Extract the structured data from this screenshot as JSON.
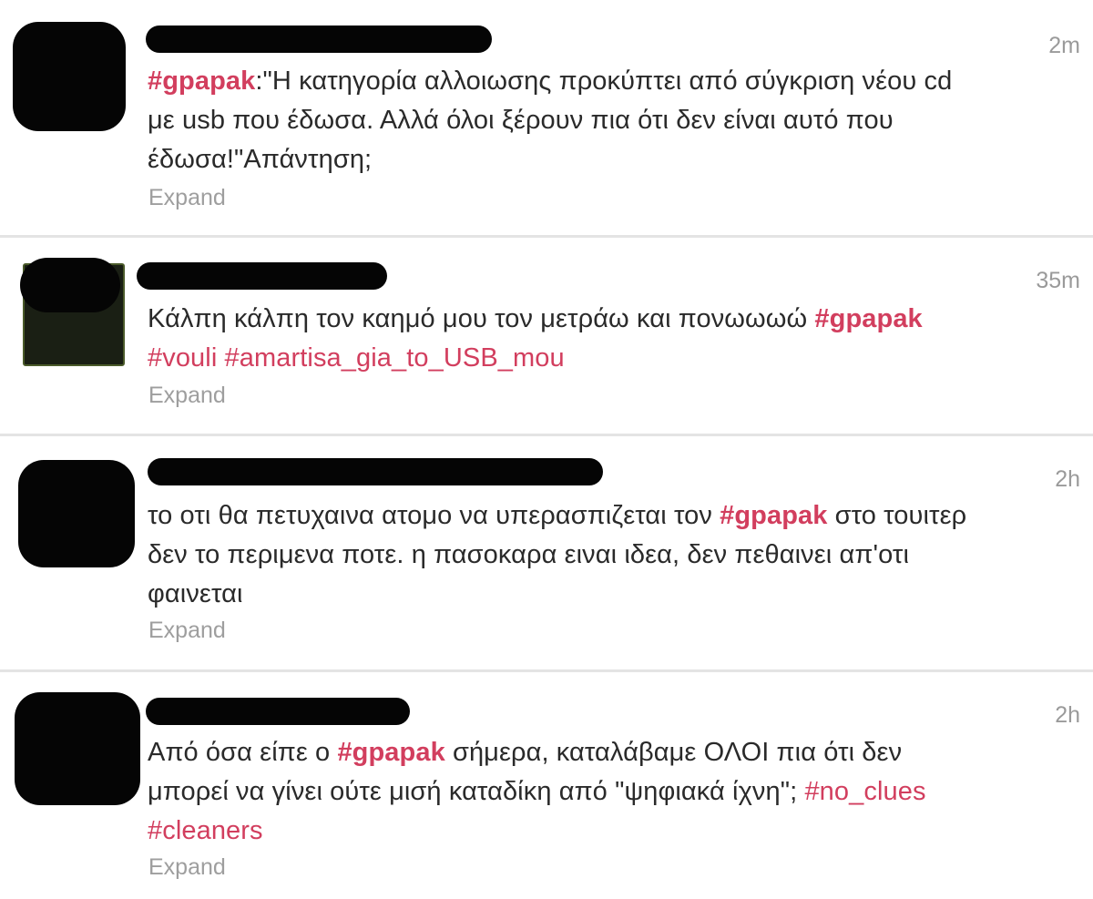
{
  "timeline": {
    "tweets": [
      {
        "time": "2m",
        "lines": [
          [
            {
              "text": "#gpapak",
              "tag": true,
              "bold": true
            },
            {
              "text": ":\"Η κατηγορία αλλοιωσης προκύπτει από σύγκριση νέου cd"
            }
          ],
          [
            {
              "text": "με usb που έδωσα. Αλλά όλοι ξέρουν πια ότι δεν είναι αυτό που"
            }
          ],
          [
            {
              "text": "έδωσα!\"Απάντηση;"
            }
          ]
        ],
        "expand": "Expand"
      },
      {
        "time": "35m",
        "lines": [
          [
            {
              "text": "Κάλπη κάλπη τον καημό μου τον μετράω και πονωωωώ "
            },
            {
              "text": "#gpapak",
              "tag": true,
              "bold": true
            }
          ],
          [
            {
              "text": "#vouli",
              "tag": true
            },
            {
              "text": " "
            },
            {
              "text": "#amartisa_gia_to_USB_mou",
              "tag": true
            }
          ]
        ],
        "expand": "Expand"
      },
      {
        "time": "2h",
        "lines": [
          [
            {
              "text": "το οτι θα πετυχαινα ατομο να υπερασπιζεται τον "
            },
            {
              "text": "#gpapak",
              "tag": true,
              "bold": true
            },
            {
              "text": " στο τουιτερ"
            }
          ],
          [
            {
              "text": "δεν το περιμενα ποτε. η πασοκαρα ειναι ιδεα, δεν πεθαινει απ'οτι"
            }
          ],
          [
            {
              "text": "φαινεται"
            }
          ]
        ],
        "expand": "Expand"
      },
      {
        "time": "2h",
        "lines": [
          [
            {
              "text": "Από όσα είπε ο "
            },
            {
              "text": "#gpapak",
              "tag": true,
              "bold": true
            },
            {
              "text": " σήμερα, καταλάβαμε ΟΛΟΙ πια ότι δεν"
            }
          ],
          [
            {
              "text": "μπορεί να γίνει ούτε μισή καταδίκη από \"ψηφιακά ίχνη\"; "
            },
            {
              "text": "#no_clues",
              "tag": true
            }
          ],
          [
            {
              "text": "#cleaners",
              "tag": true
            }
          ]
        ],
        "expand": "Expand"
      }
    ]
  },
  "colors": {
    "hashtag": "#d23e5e",
    "text": "#2a2a2a",
    "muted": "#9e9e9e",
    "divider": "#e4e4e4"
  }
}
